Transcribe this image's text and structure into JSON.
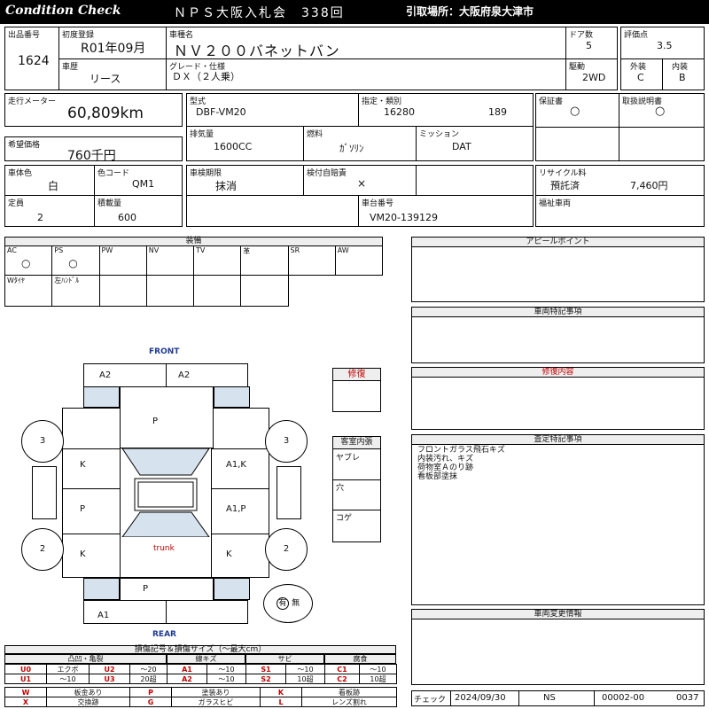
{
  "header": {
    "brand": "Condition Check",
    "auction": "ＮＰＳ大阪入札会　338回",
    "pickup": "引取場所：大阪府泉大津市"
  },
  "vehicle": {
    "lot_label": "出品番号",
    "lot": "1624",
    "first_reg_label": "初度登録",
    "first_reg": "R01年09月",
    "model_label": "車種名",
    "model": "ＮＶ２００バネットバン",
    "doors_label": "ドア数",
    "doors": "5",
    "score_label": "評価点",
    "score": "3.5",
    "history_label": "車歴",
    "history": "リース",
    "grade_label": "グレード・仕様",
    "grade": "ＤＸ（２人乗）",
    "drive_label": "駆動",
    "drive": "2WD",
    "exterior_label": "外装",
    "exterior": "C",
    "interior_label": "内装",
    "interior": "B",
    "mileage_label": "走行メーター",
    "mileage": "60,809km",
    "type_label": "型式",
    "type": "DBF-VM20",
    "class_label": "指定・類別",
    "class_no": "16280",
    "class_sub": "189",
    "warranty_label": "保証書",
    "warranty": "○",
    "manual_label": "取扱説明書",
    "manual": "○",
    "price_label": "希望価格",
    "price": "760千円",
    "displacement_label": "排気量",
    "displacement": "1600CC",
    "fuel_label": "燃料",
    "fuel": "ｶﾞｿﾘﾝ",
    "mission_label": "ミッション",
    "mission": "DAT",
    "color_label": "車体色",
    "color": "白",
    "color_code_label": "色コード",
    "color_code": "QM1",
    "inspection_label": "車検期限",
    "inspection": "抹消",
    "insurance_label": "検付自賠責",
    "insurance": "×",
    "recycle_label": "リサイクル料",
    "recycle_status": "預託済",
    "recycle_fee": "7,460円",
    "capacity_label": "定員",
    "capacity": "2",
    "load_label": "積載量",
    "load": "600",
    "chassis_label": "車台番号",
    "chassis": "VM20-139129",
    "welfare_label": "福祉車両"
  },
  "equipment": {
    "title": "装備",
    "row1": [
      {
        "label": "AC",
        "value": "○"
      },
      {
        "label": "PS",
        "value": "○"
      },
      {
        "label": "PW",
        "value": ""
      },
      {
        "label": "NV",
        "value": ""
      },
      {
        "label": "TV",
        "value": ""
      },
      {
        "label": "革",
        "value": ""
      },
      {
        "label": "SR",
        "value": ""
      },
      {
        "label": "AW",
        "value": ""
      }
    ],
    "row2": [
      {
        "label": "Wﾀｲﾔ"
      },
      {
        "label": "左ﾊﾝﾄﾞﾙ"
      },
      {
        "label": ""
      },
      {
        "label": ""
      },
      {
        "label": ""
      },
      {
        "label": ""
      }
    ]
  },
  "diagram": {
    "front": "FRONT",
    "rear": "REAR",
    "trunk": "trunk",
    "marks": {
      "front_left": "A2",
      "front_right": "A2",
      "hood": "P",
      "tire_fl": "3",
      "tire_fr": "3",
      "tire_rl": "2",
      "tire_rr": "2",
      "door_fl": "K",
      "door_fr": "A1,K",
      "door_rl": "P",
      "door_rr": "A1,P",
      "quarter_l": "K",
      "quarter_r": "K",
      "back": "P",
      "bumper_rear": "A1"
    },
    "spare_yes": "有",
    "spare_no": "無"
  },
  "side_boxes": {
    "repair_title": "修復",
    "interior_title": "客室内張",
    "interior_items": [
      "ヤブレ",
      "穴",
      "コゲ"
    ]
  },
  "panels": {
    "appeal": "アピールポイント",
    "special": "車両特記事項",
    "repair_detail": "修復内容",
    "inspection_notes_title": "査定特記事項",
    "inspection_notes": [
      "フロントガラス飛石キズ",
      "内装汚れ、キズ",
      "荷物室Ａのり跡",
      "看板部塗抹"
    ],
    "change_info": "車両変更情報"
  },
  "legend": {
    "title": "損傷記号＆損傷サイズ（～最大cm）",
    "groups": [
      "凸凹・亀裂",
      "線キズ",
      "サビ",
      "腐食"
    ],
    "rows": [
      [
        [
          "U0",
          "エクボ"
        ],
        [
          "U2",
          "～20"
        ],
        [
          "A1",
          "～10"
        ],
        [
          "S1",
          "～10"
        ],
        [
          "C1",
          "～10"
        ]
      ],
      [
        [
          "U1",
          "～10"
        ],
        [
          "U3",
          "20超"
        ],
        [
          "A2",
          "～10"
        ],
        [
          "S2",
          "10超"
        ],
        [
          "C2",
          "10超"
        ]
      ]
    ],
    "rows2": [
      [
        [
          "W",
          "板金あり"
        ],
        [
          "P",
          "塗装あり"
        ],
        [
          "K",
          "看板跡"
        ]
      ],
      [
        [
          "X",
          "交換跡"
        ],
        [
          "G",
          "ガラスヒビ"
        ],
        [
          "L",
          "レンズ割れ"
        ]
      ]
    ]
  },
  "footer": {
    "check_label": "チェック",
    "date": "2024/09/30",
    "inspector": "NS",
    "code1": "00002-00",
    "code2": "0037"
  }
}
